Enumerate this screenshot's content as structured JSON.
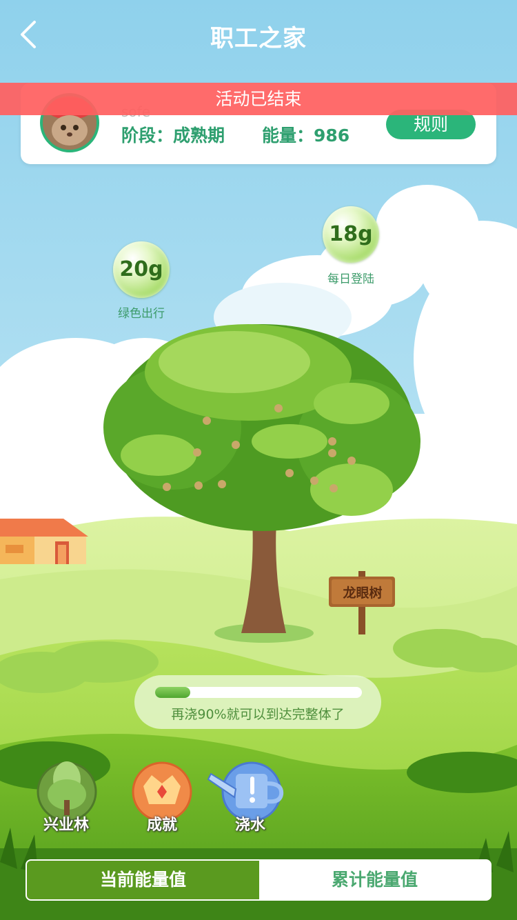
{
  "header": {
    "title": "职工之家",
    "back_icon": "chevron-left-icon"
  },
  "banner": {
    "text": "活动已结束"
  },
  "profile": {
    "username": "sofe",
    "stage": "阶段：成熟期",
    "energy": "能量：986",
    "rules_label": "规则"
  },
  "bubbles": [
    {
      "value": "20g",
      "label": "绿色出行"
    },
    {
      "value": "18g",
      "label": "每日登陆"
    }
  ],
  "tree": {
    "sign": "龙眼树"
  },
  "progress": {
    "fraction": 0.1,
    "text": "再浇90%就可以到达完整体了"
  },
  "actions": [
    {
      "label": "兴业林",
      "icon": "forest-icon"
    },
    {
      "label": "成就",
      "icon": "crown-icon"
    },
    {
      "label": "浇水",
      "icon": "watering-can-icon"
    }
  ],
  "tabs": {
    "current": "当前能量值",
    "total": "累计能量值"
  },
  "colors": {
    "accent": "#2bb57a",
    "banner": "#ff6060",
    "tab_active": "#5a9a1f"
  }
}
